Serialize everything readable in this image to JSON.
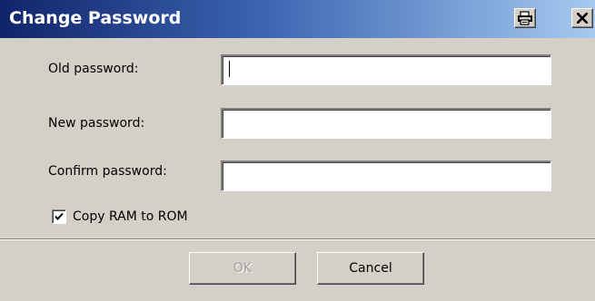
{
  "dialog": {
    "title": "Change Password",
    "title_buttons": [
      {
        "icon": "printer-icon"
      },
      {
        "icon": "close-icon"
      }
    ]
  },
  "form": {
    "old_password": {
      "label": "Old password:",
      "value": ""
    },
    "new_password": {
      "label": "New password:",
      "value": ""
    },
    "confirm_password": {
      "label": "Confirm password:",
      "value": ""
    },
    "copy_ram_to_rom": {
      "label": "Copy RAM to ROM",
      "checked": true
    }
  },
  "buttons": {
    "ok": {
      "label": "OK",
      "enabled": false
    },
    "cancel": {
      "label": "Cancel",
      "enabled": true
    }
  },
  "colors": {
    "titlebar_start": "#10246a",
    "titlebar_end": "#a6caf0",
    "dialog_bg": "#d4d0c8"
  }
}
